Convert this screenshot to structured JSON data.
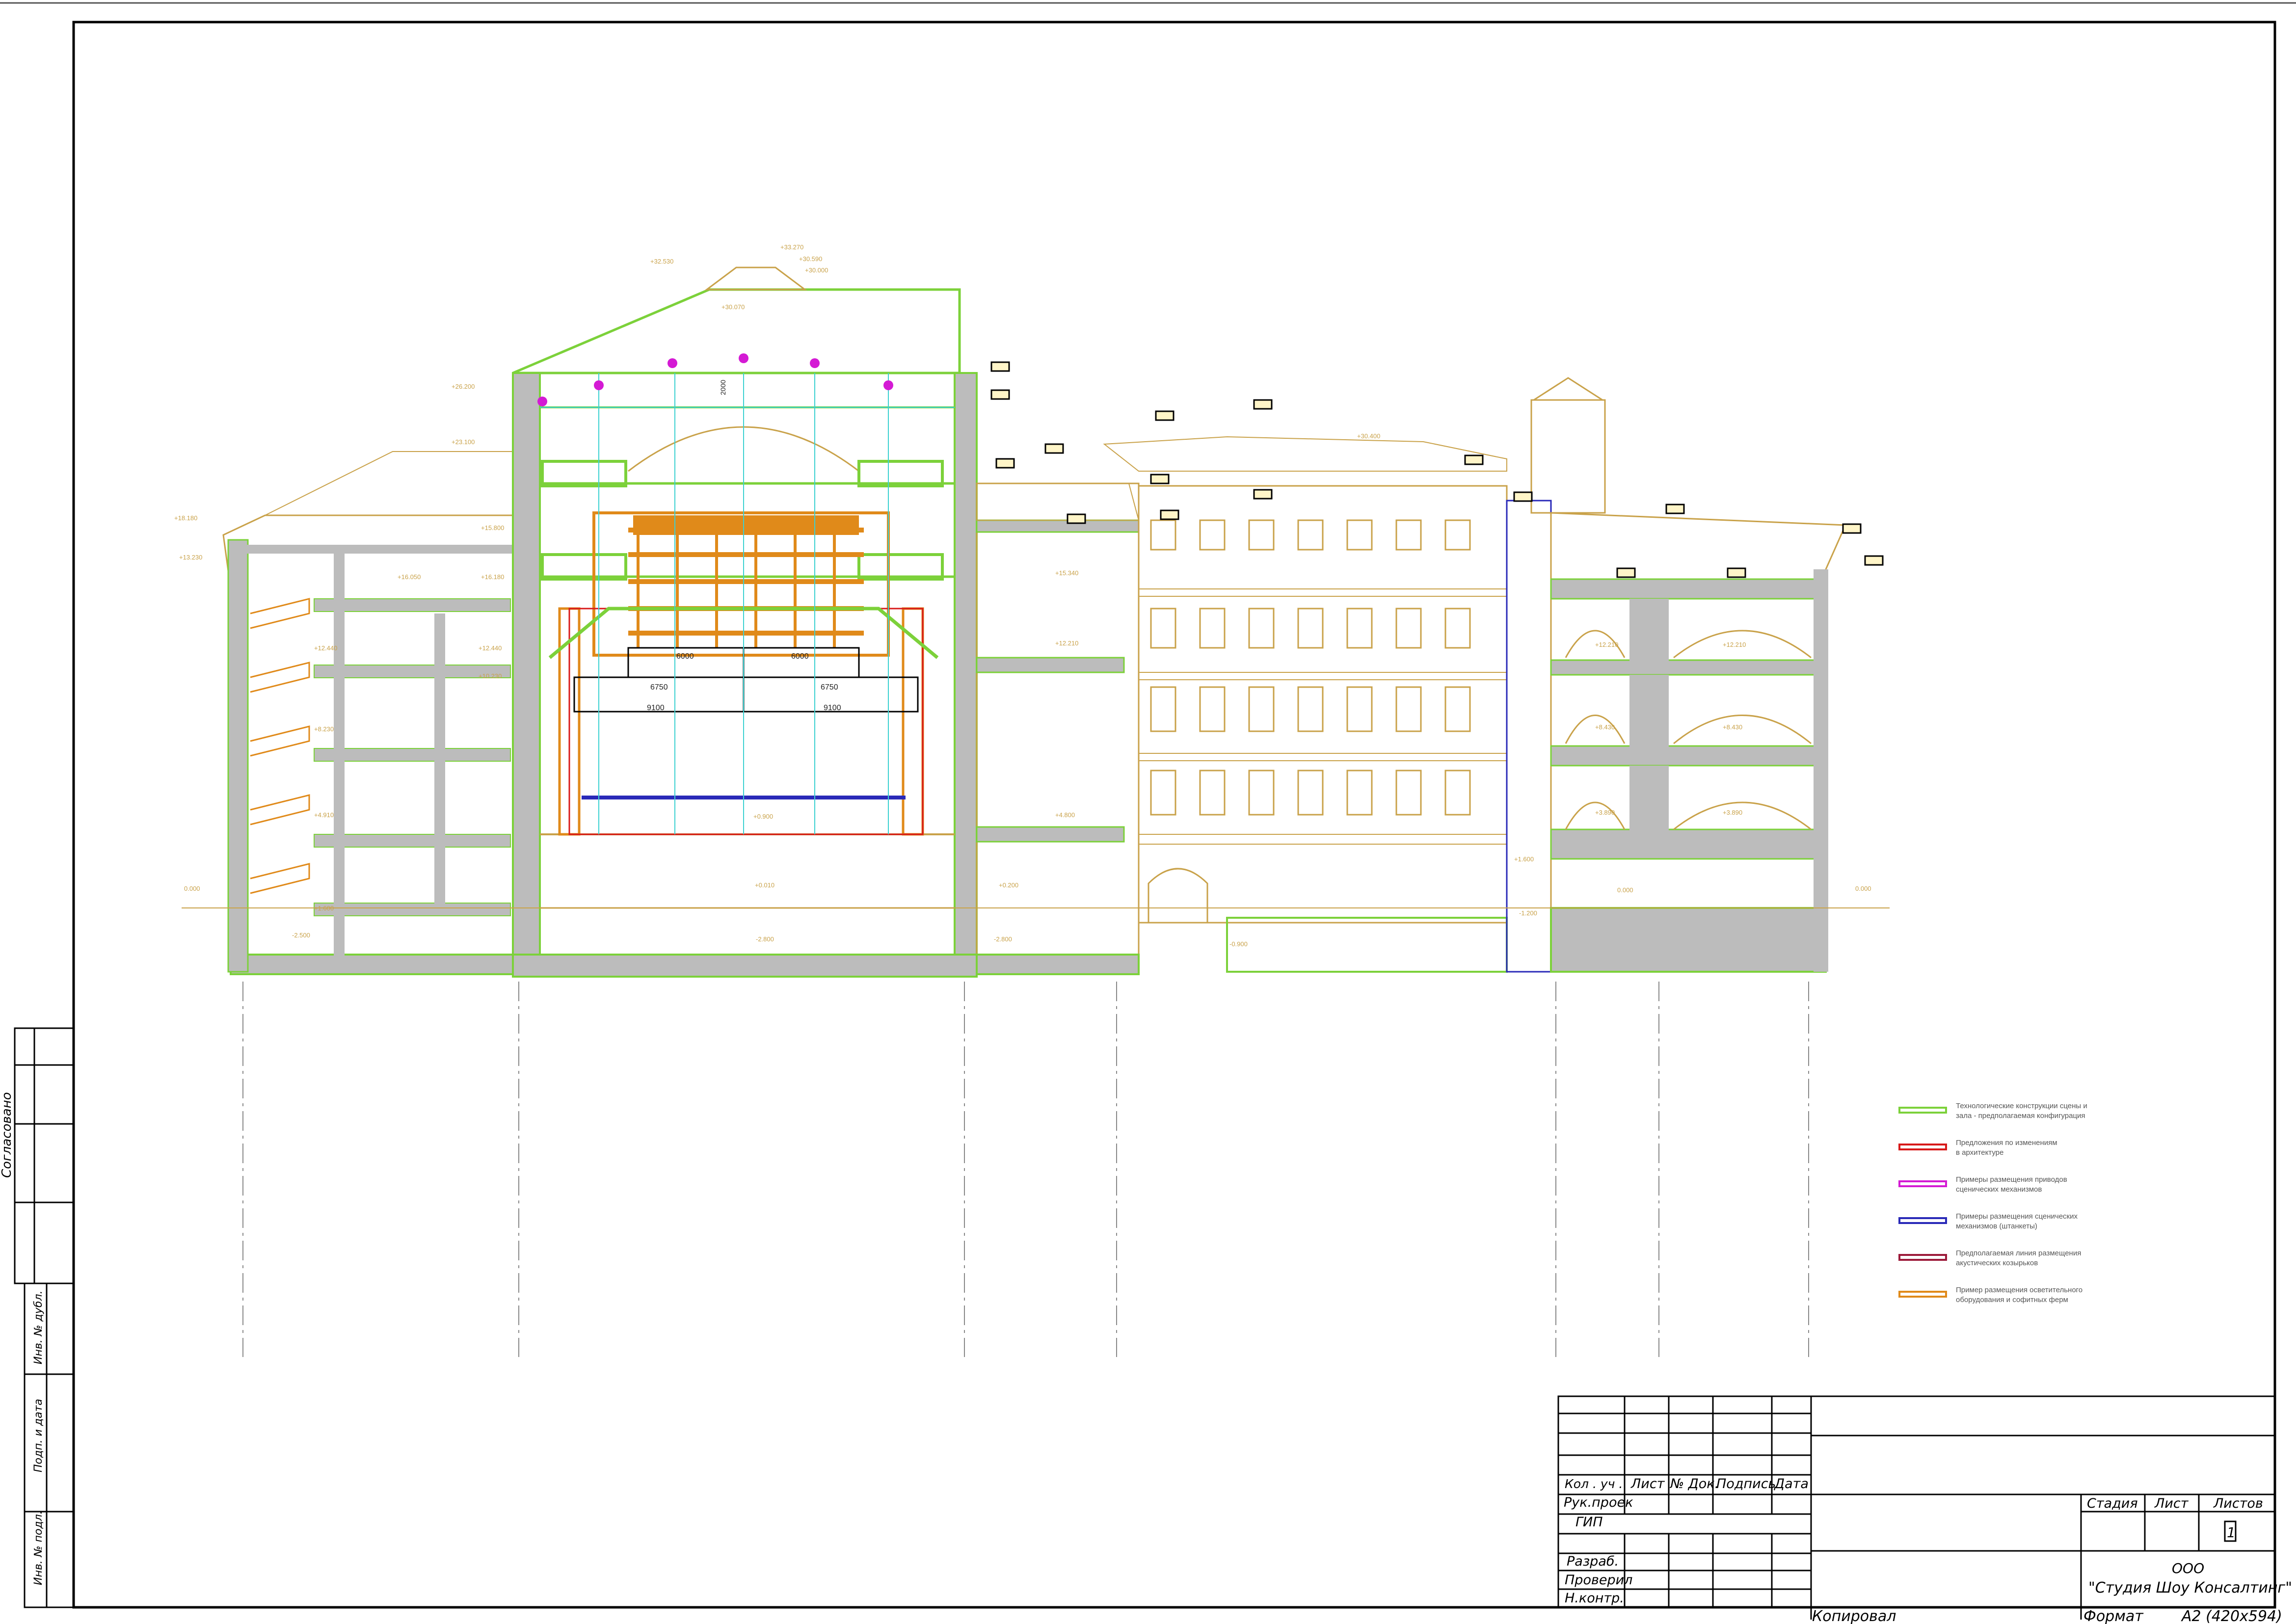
{
  "title_block": {
    "col_headers": {
      "kol_uch": "Кол . уч .",
      "list": "Лист",
      "doc_no": "№ Док.",
      "signature": "Подпись",
      "date": "Дата"
    },
    "roles": {
      "head": "Рук.проек",
      "gip": "ГИП",
      "developer": "Разраб.",
      "checker": "Проверил",
      "norm_control": "Н.контр."
    },
    "stage_label": "Стадия",
    "sheet_label": "Лист",
    "sheets_label": "Листов",
    "sheets_value": "1",
    "org_line1": "ООО",
    "org_line2": "\"Студия Шоу Консалтинг\"",
    "copied_label": "Копировал",
    "format_label": "Формат",
    "format_value": "А2 (420х594)"
  },
  "left_stamp": {
    "agreed": "Согласовано",
    "inv_no": "Инв. № дубл.",
    "sign_date": "Подп. и дата",
    "inv_orig": "Инв. № подл."
  },
  "legend": [
    {
      "color": "#7cd13a",
      "line1": "Технологические конструкции сцены и",
      "line2": "зала - предполагаемая конфигурация"
    },
    {
      "color": "#d81a1a",
      "line1": "Предложения по изменениям",
      "line2": "в архитектуре"
    },
    {
      "color": "#d41ad4",
      "line1": "Примеры размещения приводов",
      "line2": "сценических механизмов"
    },
    {
      "color": "#2a2ab8",
      "line1": "Примеры размещения сценических",
      "line2": "механизмов (штанкеты)"
    },
    {
      "color": "#9c1a3a",
      "line1": "Предполагаемая линия размещения",
      "line2": "акустических козырьков"
    },
    {
      "color": "#e08a1a",
      "line1": "Пример размещения осветительного",
      "line2": "оборудования и софитных ферм"
    }
  ],
  "dimensions": {
    "d6000a": "6000",
    "d6000b": "6000",
    "d6750a": "6750",
    "d6750b": "6750",
    "d9100a": "9100",
    "d9100b": "9100",
    "d2000": "2000"
  },
  "levels": {
    "l_top": "+33.270",
    "l_top2": "+30.590",
    "l_top3": "+30.000",
    "l_ridge_left": "+32.530",
    "l_ridge_in": "+30.070",
    "l_left_roof": "+26.200",
    "l_left_mid": "+23.100",
    "l_far_left": "+18.180",
    "l_far_left2": "+13.230",
    "l_right_roof": "+30.400",
    "l_stage_grid": "+15.800",
    "l_stage_r": "+16.180",
    "l_plus12": "+12.440",
    "l_plus10": "+10.230",
    "l_stage_floor": "+0.900",
    "l_stage_lower": "+0.010",
    "l_zero_left": "0.000",
    "l_zero_right": "0.000",
    "l_zero_r2": "0.000",
    "l_minus_left": "-2.500",
    "l_minus_mid": "-2.800",
    "l_minus_right": "-2.800",
    "l_r12": "+12.210",
    "l_r12b": "+12.210",
    "l_r8": "+8.430",
    "l_r8b": "+8.430",
    "l_r4": "+3.890",
    "l_r4b": "+3.890",
    "l_mid_15": "+15.340",
    "l_mid_12": "+12.210",
    "l_mid_4": "+4.800",
    "l_mid_0": "+0.200",
    "l_left_16": "+16.050",
    "l_left_12": "+12.440",
    "l_left_8": "+8.230",
    "l_left_4": "+4.910",
    "l_left_small": "+1.600",
    "l_atrium": "+1.600",
    "l_atrium2": "-1.200",
    "l_court": "-0.900"
  }
}
